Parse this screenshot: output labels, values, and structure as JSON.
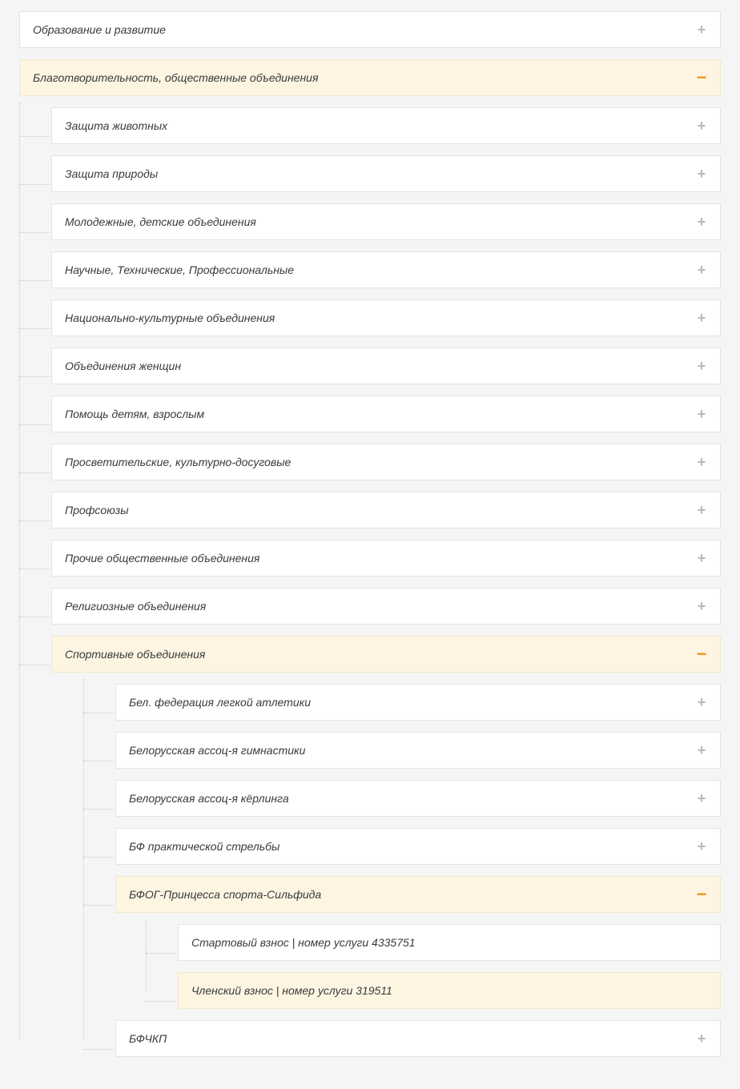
{
  "tree": [
    {
      "label": "Образование и развитие",
      "expanded": false
    },
    {
      "label": "Благотворительность, общественные объединения",
      "expanded": true,
      "children": [
        {
          "label": "Защита животных",
          "expanded": false
        },
        {
          "label": "Защита природы",
          "expanded": false
        },
        {
          "label": "Молодежные, детские объединения",
          "expanded": false
        },
        {
          "label": "Научные, Технические, Профессиональные",
          "expanded": false
        },
        {
          "label": "Национально-культурные объединения",
          "expanded": false
        },
        {
          "label": "Объединения женщин",
          "expanded": false
        },
        {
          "label": "Помощь детям, взрослым",
          "expanded": false
        },
        {
          "label": "Просветительские, культурно-досуговые",
          "expanded": false
        },
        {
          "label": "Профсоюзы",
          "expanded": false
        },
        {
          "label": "Прочие общественные объединения",
          "expanded": false
        },
        {
          "label": "Религиозные объединения",
          "expanded": false
        },
        {
          "label": "Спортивные объединения",
          "expanded": true,
          "children": [
            {
              "label": "Бел. федерация легкой атлетики",
              "expanded": false
            },
            {
              "label": "Белорусская ассоц-я гимнастики",
              "expanded": false
            },
            {
              "label": "Белорусская ассоц-я кёрлинга",
              "expanded": false
            },
            {
              "label": "БФ практической стрельбы",
              "expanded": false
            },
            {
              "label": "БФОГ-Принцесса спорта-Сильфида",
              "expanded": true,
              "children": [
                {
                  "label": "Стартовый взнос | номер услуги 4335751",
                  "leaf": true,
                  "selected": false
                },
                {
                  "label": "Членский взнос | номер услуги 319511",
                  "leaf": true,
                  "selected": true
                }
              ]
            },
            {
              "label": "БФЧКП",
              "expanded": false
            }
          ]
        }
      ]
    }
  ]
}
